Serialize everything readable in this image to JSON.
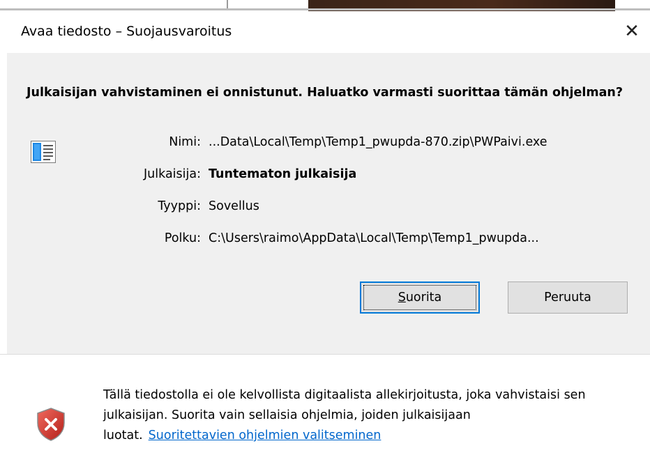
{
  "window": {
    "title": "Avaa tiedosto – Suojausvaroitus",
    "close_label": "✕"
  },
  "heading": "Julkaisijan vahvistaminen ei onnistunut. Haluatko varmasti suorittaa tämän ohjelman?",
  "details": {
    "name_label": "Nimi:",
    "name_value": "...Data\\Local\\Temp\\Temp1_pwupda-870.zip\\PWPaivi.exe",
    "publisher_label": "Julkaisija:",
    "publisher_value": "Tuntematon julkaisija",
    "type_label": "Tyyppi:",
    "type_value": "Sovellus",
    "path_label": "Polku:",
    "path_value": "C:\\Users\\raimo\\AppData\\Local\\Temp\\Temp1_pwupda..."
  },
  "buttons": {
    "run_accel": "S",
    "run_rest": "uorita",
    "cancel": "Peruuta"
  },
  "warning": {
    "text": "Tällä tiedostolla ei ole kelvollista digitaalista allekirjoitusta, joka vahvistaisi sen julkaisijan. Suorita vain sellaisia ohjelmia, joiden julkaisijaan luotat.",
    "link": "Suoritettavien ohjelmien valitseminen"
  },
  "icons": {
    "app": "application-window-icon",
    "shield": "shield-error-icon"
  },
  "colors": {
    "panel": "#f0f0f0",
    "primary_border": "#0078d7",
    "link": "#0066cc",
    "shield_red": "#d4342c"
  }
}
